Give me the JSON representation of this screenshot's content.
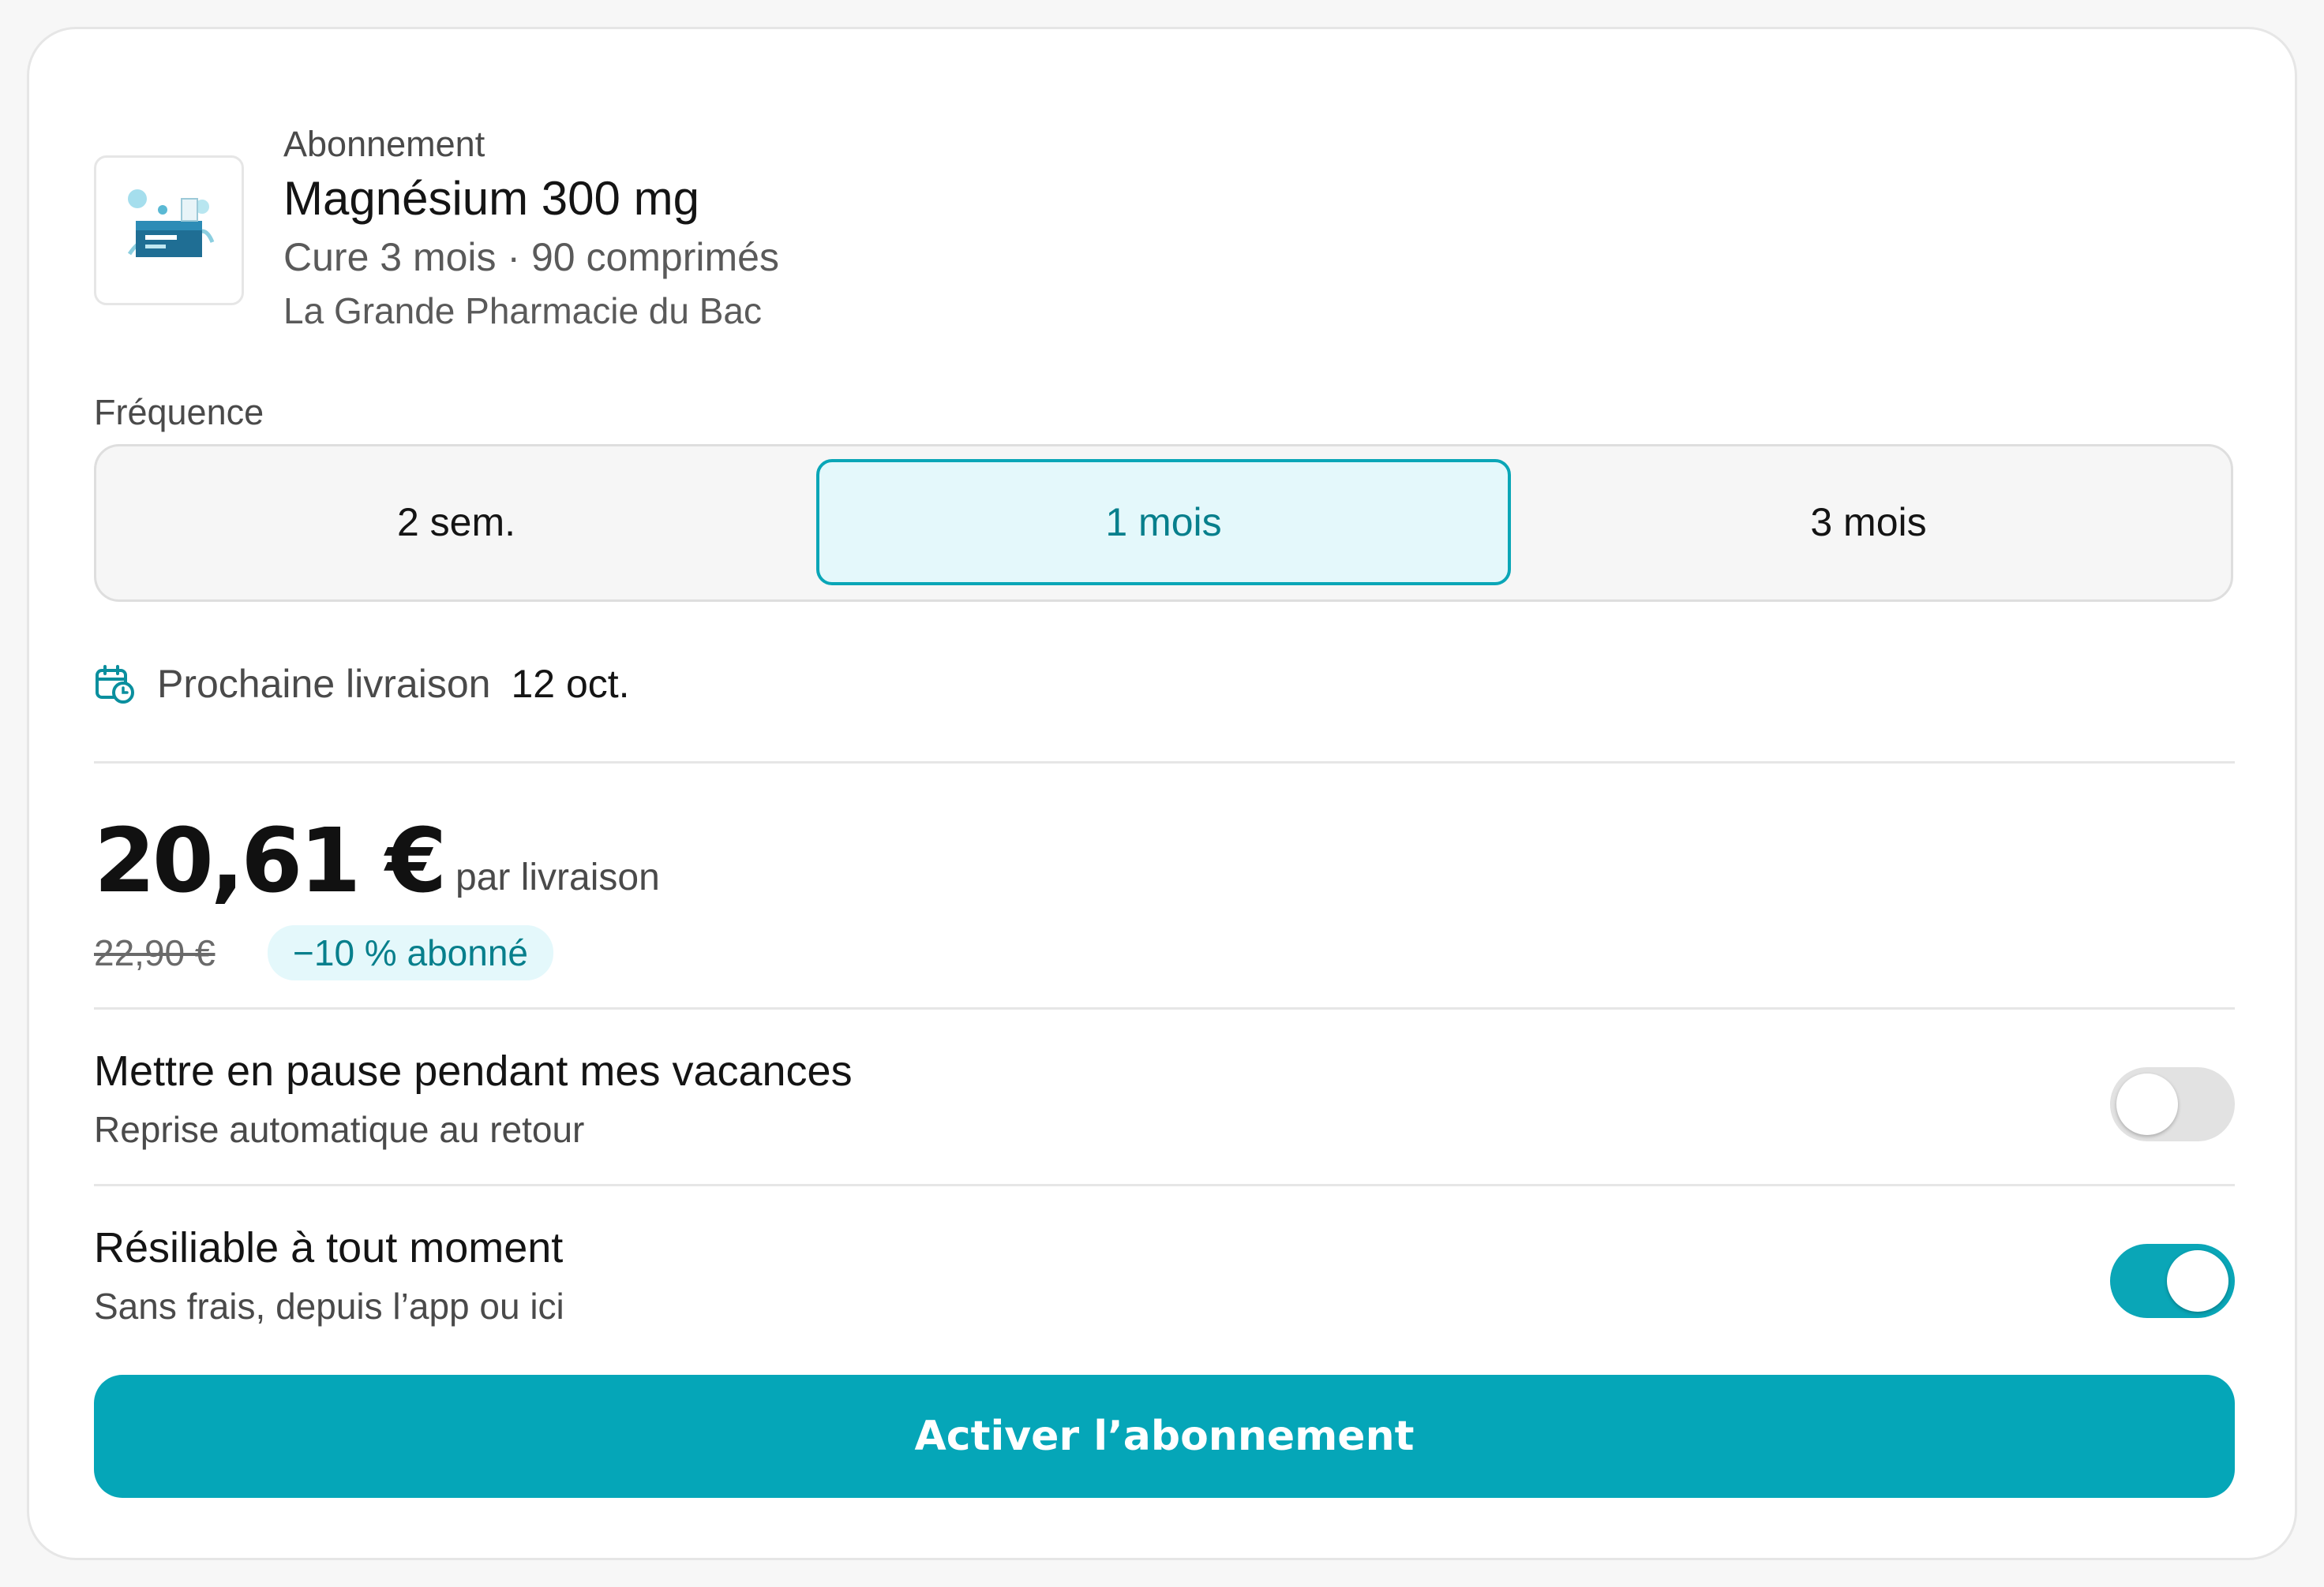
{
  "product": {
    "eyebrow": "Abonnement",
    "title": "Magnésium 300 mg",
    "meta": "Cure 3 mois · 90 comprimés",
    "pharmacy": "La Grande Pharmacie du Bac",
    "thumb_icon": "product-box-icon"
  },
  "frequency": {
    "label": "Fréquence",
    "options": [
      "2 sem.",
      "1 mois",
      "3 mois"
    ],
    "selected": "1 mois"
  },
  "delivery": {
    "icon": "calendar-clock-icon",
    "label": "Prochaine livraison",
    "date": "12 oct."
  },
  "pricing": {
    "price": "20,61 €",
    "per": "par livraison",
    "old_price": "22,90 €",
    "discount_badge": "−10 % abonné"
  },
  "options": {
    "pause": {
      "title": "Mettre en pause pendant mes vacances",
      "subtitle": "Reprise automatique au retour",
      "enabled": false
    },
    "cancel": {
      "title": "Résiliable à tout moment",
      "subtitle": "Sans frais, depuis l’app ou ici",
      "enabled": true
    }
  },
  "cta": {
    "label": "Activer l’abonnement"
  },
  "colors": {
    "accent": "#05a6b8",
    "accent_text": "#077f8c",
    "accent_bg": "#e4f8fb"
  }
}
